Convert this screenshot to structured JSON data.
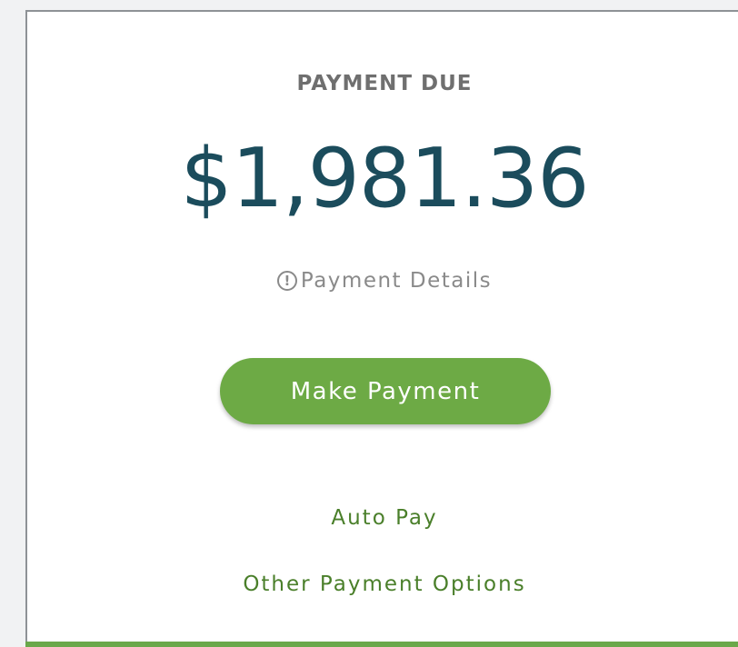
{
  "payment": {
    "title": "PAYMENT DUE",
    "amount": "$1,981.36",
    "details_label": "Payment Details",
    "details_icon": "info-circle-icon",
    "make_payment_label": "Make Payment",
    "auto_pay_label": "Auto Pay",
    "other_options_label": "Other Payment Options"
  },
  "colors": {
    "amount": "#1b4c5c",
    "button": "#6daa45",
    "link": "#4a7f2a",
    "accent_bar": "#6aa84a"
  }
}
